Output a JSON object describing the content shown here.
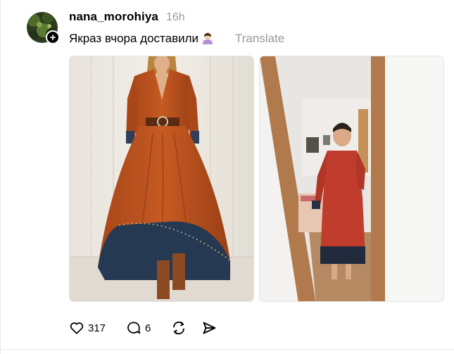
{
  "post": {
    "username": "nana_morohiya",
    "time": "16h",
    "text": "Якраз вчора доставили",
    "translate_label": "Translate",
    "emoji_icon": "person-shrugging-emoji",
    "follow_icon": "plus-icon",
    "images": [
      {
        "description": "rust orange maxi dress with navy hem"
      },
      {
        "description": "mirror selfie in red dress"
      }
    ]
  },
  "actions": {
    "like_count": "317",
    "reply_count": "6"
  },
  "colors": {
    "text": "#000000",
    "muted": "#999999",
    "border": "#e6e6e6"
  }
}
